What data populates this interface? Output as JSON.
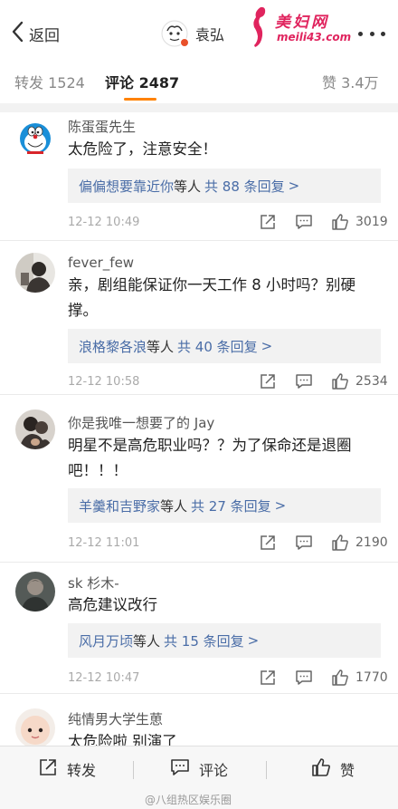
{
  "nav": {
    "back_label": "返回",
    "title": "袁弘",
    "watermark_title": "美妇网",
    "watermark_url": "meili43.com"
  },
  "tabs": {
    "repost": "转发 1524",
    "comment": "评论 2487",
    "like": "赞 3.4万",
    "active_color": "#ff8200"
  },
  "comments": [
    {
      "username": "陈蛋蛋先生",
      "text": "太危险了，注意安全！",
      "reply_names": "偏偏想要靠近你",
      "reply_suffix": "等人",
      "reply_count": "共 88 条回复",
      "reply_arrow": ">",
      "time": "12-12 10:49",
      "likes": "3019",
      "avatar_icon": "doraemon-avatar-icon"
    },
    {
      "username": "fever_few",
      "text": "亲，剧组能保证你一天工作 8 小时吗？别硬撑。",
      "reply_names": "浪格黎各浪",
      "reply_suffix": "等人",
      "reply_count": "共 40 条回复",
      "reply_arrow": ">",
      "time": "12-12 10:58",
      "likes": "2534",
      "avatar_icon": "photo-avatar-icon"
    },
    {
      "username": "你是我唯一想要了的 Jay",
      "text": "明星不是高危职业吗？？为了保命还是退圈吧！！！",
      "reply_names": "羊羹和吉野家",
      "reply_suffix": "等人",
      "reply_count": "共 27 条回复",
      "reply_arrow": ">",
      "time": "12-12 11:01",
      "likes": "2190",
      "avatar_icon": "photo-avatar-icon"
    },
    {
      "username": "sk 杉木-",
      "text": "高危建议改行",
      "reply_names": "风月万顷",
      "reply_suffix": "等人",
      "reply_count": "共 15 条回复",
      "reply_arrow": ">",
      "time": "12-12 10:47",
      "likes": "1770",
      "avatar_icon": "photo-avatar-icon"
    },
    {
      "username": "纯情男大学生葸",
      "text": "太危险啦 别演了",
      "avatar_icon": "baby-avatar-icon"
    }
  ],
  "bottom": {
    "repost": "转发",
    "comment": "评论",
    "like": "赞",
    "source_tag": "@八组热区娱乐圈"
  },
  "icons": {
    "back": "chevron-left-icon",
    "more": "more-dots-icon",
    "share": "share-icon",
    "reply": "reply-icon",
    "like": "thumbs-up-icon"
  }
}
